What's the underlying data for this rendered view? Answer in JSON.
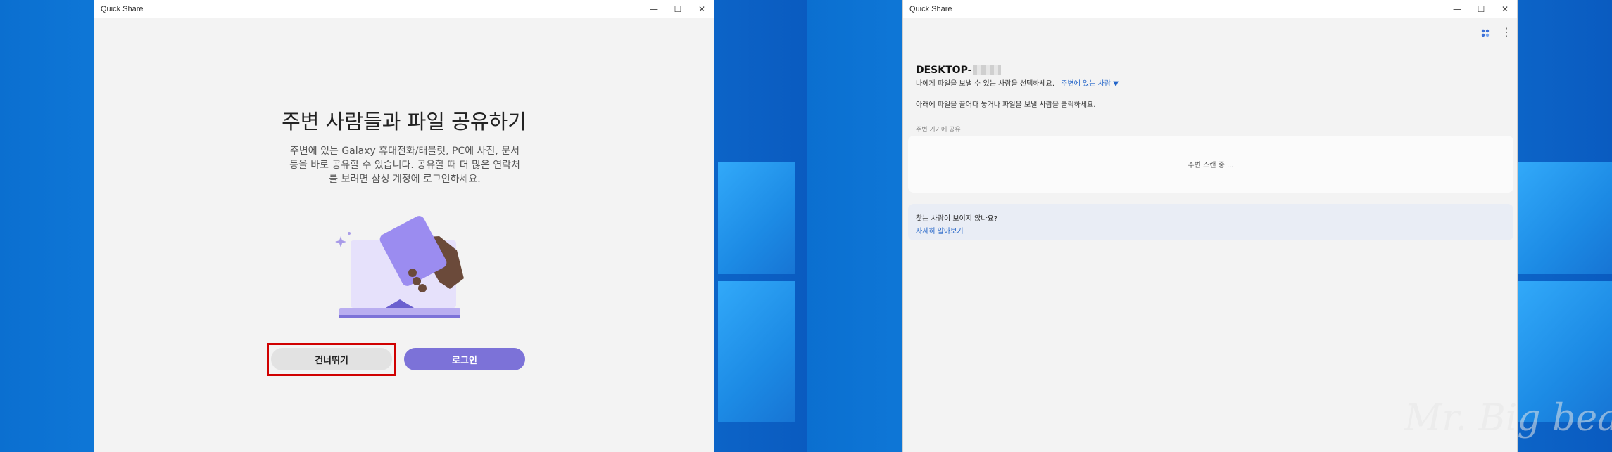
{
  "left_window": {
    "title": "Quick Share",
    "heading": "주변 사람들과 파일 공유하기",
    "description": "주변에 있는 Galaxy 휴대전화/태블릿, PC에 사진, 문서 등을 바로 공유할 수 있습니다. 공유할 때 더 많은 연락처를 보려면 삼성 계정에 로그인하세요.",
    "skip_label": "건너뛰기",
    "login_label": "로그인"
  },
  "right_window": {
    "title": "Quick Share",
    "device_name": "DESKTOP-",
    "visibility_text": "나에게 파일을 보낼 수 있는 사람을 선택하세요.",
    "visibility_option": "주변에 있는 사람",
    "drag_hint": "아래에 파일을 끌어다 놓거나 파일을 보낼 사람을 클릭하세요.",
    "section_label": "주변 기기에 공유",
    "scanning_text": "주변 스캔 중 ...",
    "help_question": "찾는 사람이 보이지 않나요?",
    "help_link": "자세히 알아보기"
  },
  "window_controls": {
    "minimize": "—",
    "maximize": "☐",
    "close": "✕"
  },
  "icons": {
    "grid": "nearby-share-icon",
    "more": "more-vert-icon",
    "dropdown": "▼"
  },
  "watermark": "Mr. Big bear.",
  "colors": {
    "accent": "#7c72d8",
    "link": "#2264c8",
    "highlight": "#d00000"
  }
}
